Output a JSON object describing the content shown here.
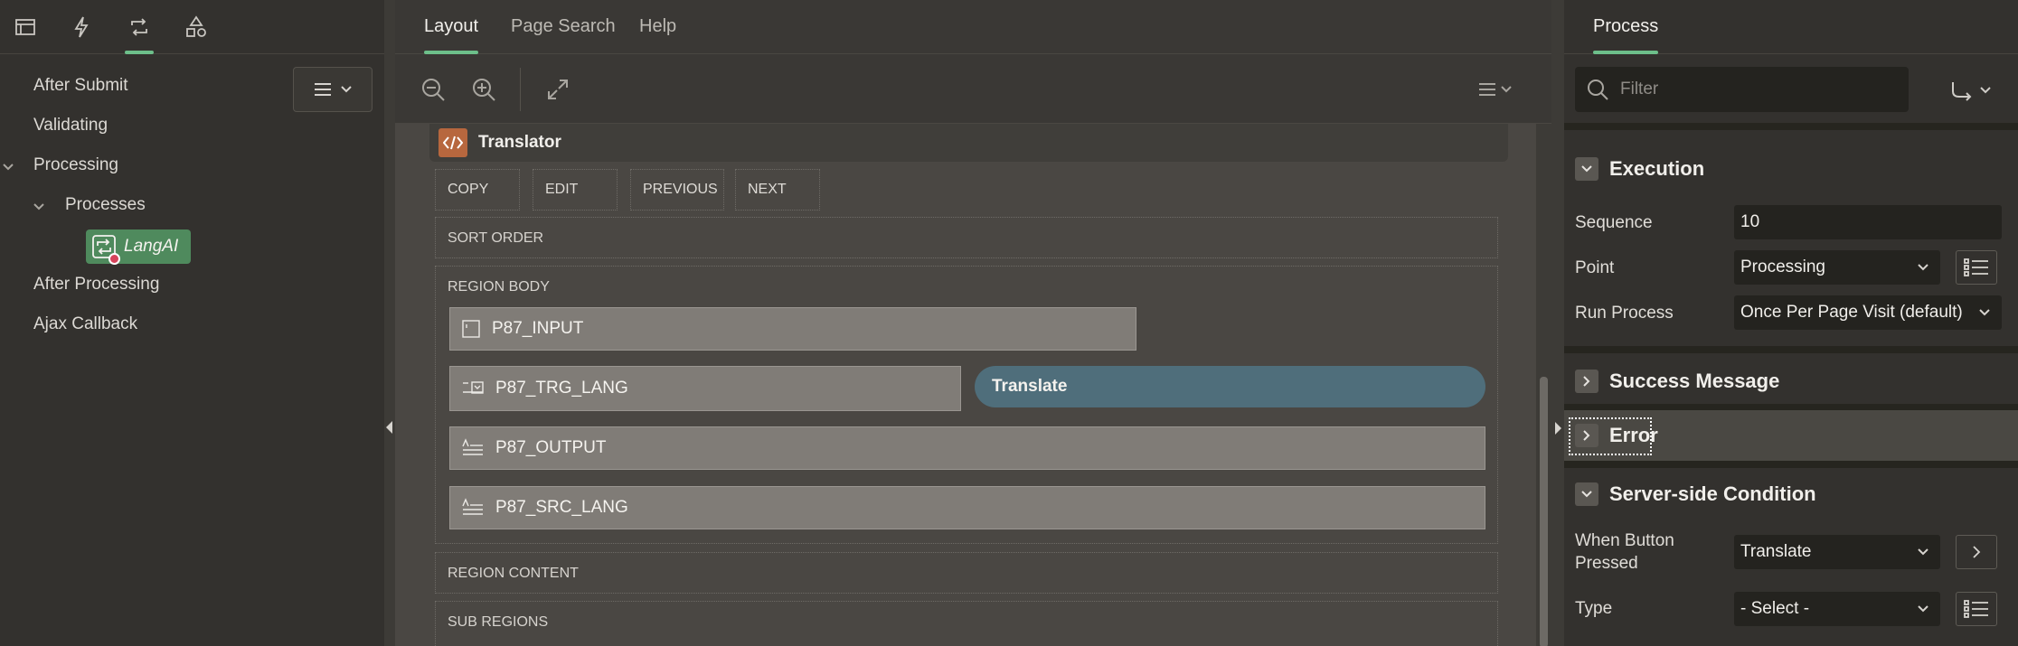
{
  "left": {
    "tabs": [
      "rendering-tab",
      "dynamic-actions-tab",
      "processing-tab",
      "shared-components-tab"
    ],
    "tree": {
      "after_submit": "After Submit",
      "validating": "Validating",
      "processing": "Processing",
      "processes": "Processes",
      "langai": "LangAI",
      "after_processing": "After Processing",
      "ajax_callback": "Ajax Callback"
    }
  },
  "center": {
    "tabs": {
      "layout": "Layout",
      "page_search": "Page Search",
      "help": "Help"
    },
    "region_title": "Translator",
    "buttons": {
      "copy": "COPY",
      "edit": "EDIT",
      "previous": "PREVIOUS",
      "next": "NEXT"
    },
    "sort_order": "SORT ORDER",
    "region_body": "REGION BODY",
    "items": {
      "input": "P87_INPUT",
      "trg_lang": "P87_TRG_LANG",
      "output": "P87_OUTPUT",
      "src_lang": "P87_SRC_LANG"
    },
    "translate_button": "Translate",
    "region_content": "REGION CONTENT",
    "sub_regions": "SUB REGIONS"
  },
  "right": {
    "tab": "Process",
    "filter_placeholder": "Filter",
    "sections": {
      "execution": "Execution",
      "success_message": "Success Message",
      "error": "Error",
      "server_side_condition": "Server-side Condition"
    },
    "props": {
      "sequence_label": "Sequence",
      "sequence_value": "10",
      "point_label": "Point",
      "point_value": "Processing",
      "run_process_label": "Run Process",
      "run_process_value": "Once Per Page Visit (default)",
      "when_button_label": "When Button Pressed",
      "when_button_value": "Translate",
      "type_label": "Type",
      "type_value": "- Select -"
    }
  },
  "colors": {
    "accent": "#6dbf8a",
    "selected_node": "#4f8a5d",
    "translate_button": "#4f6e7b",
    "code_icon": "#b7673e"
  }
}
